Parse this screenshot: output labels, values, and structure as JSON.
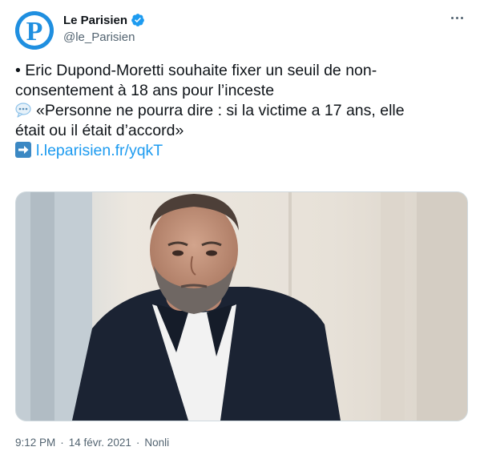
{
  "author": {
    "display_name": "Le Parisien",
    "handle": "@le_Parisien",
    "avatar_letter": "P"
  },
  "tweet": {
    "line1": "• Eric Dupond-Moretti souhaite fixer un seuil de non-",
    "line2": "consentement à 18 ans pour l’inceste",
    "line3": "«Personne ne pourra dire : si la victime a 17 ans, elle",
    "line4": "était ou il était d’accord»",
    "link_text": "l.leparisien.fr/yqkT"
  },
  "meta": {
    "time": "9:12 PM",
    "separator": "·",
    "date": "14 févr. 2021",
    "source": "Nonli"
  },
  "colors": {
    "link": "#1d9bf0",
    "secondary_text": "#536471",
    "verified_badge": "#1d9bf0",
    "avatar_bg": "#1f8fe0"
  },
  "icons": {
    "verified": "verified-badge-icon",
    "more": "more-options-icon",
    "speech": "speech-balloon-emoji",
    "arrow": "right-arrow-emoji"
  }
}
